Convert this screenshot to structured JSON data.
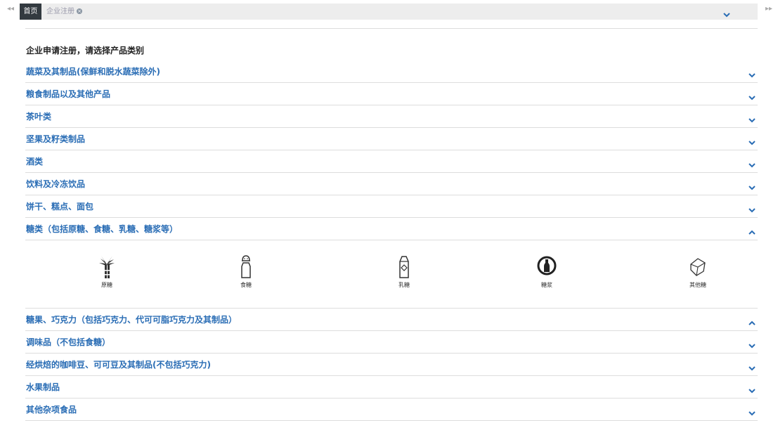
{
  "tabs": {
    "home": "首页",
    "current": "企业注册",
    "close_icon": "close-circle-icon"
  },
  "nav": {
    "left": "◂◂",
    "right": "▸▸"
  },
  "intro": "企业申请注册，请选择产品类别",
  "categories": [
    "蔬菜及其制品(保鲜和脱水蔬菜除外)",
    "粮食制品以及其他产品",
    "茶叶类",
    "坚果及籽类制品",
    "酒类",
    "饮料及冷冻饮品",
    "饼干、糕点、面包",
    "糖类（包括原糖、食糖、乳糖、糖浆等）",
    "糖果、巧克力（包括巧克力、代可可脂巧克力及其制品）",
    "调味品（不包括食糖）",
    "经烘焙的咖啡豆、可可豆及其制品(不包括巧克力)",
    "水果制品",
    "其他杂项食品"
  ],
  "expanded_index": 7,
  "subcategories": [
    {
      "label": "原糖",
      "icon": "sugarcane-icon"
    },
    {
      "label": "食糖",
      "icon": "sugar-shaker-icon"
    },
    {
      "label": "乳糖",
      "icon": "milk-carton-icon"
    },
    {
      "label": "糖浆",
      "icon": "syrup-bottle-icon"
    },
    {
      "label": "其他糖",
      "icon": "sugar-cube-icon"
    }
  ],
  "colors": {
    "link": "#2a6db5",
    "chevron": "#2a6db5",
    "home_tab": "#333a40"
  }
}
